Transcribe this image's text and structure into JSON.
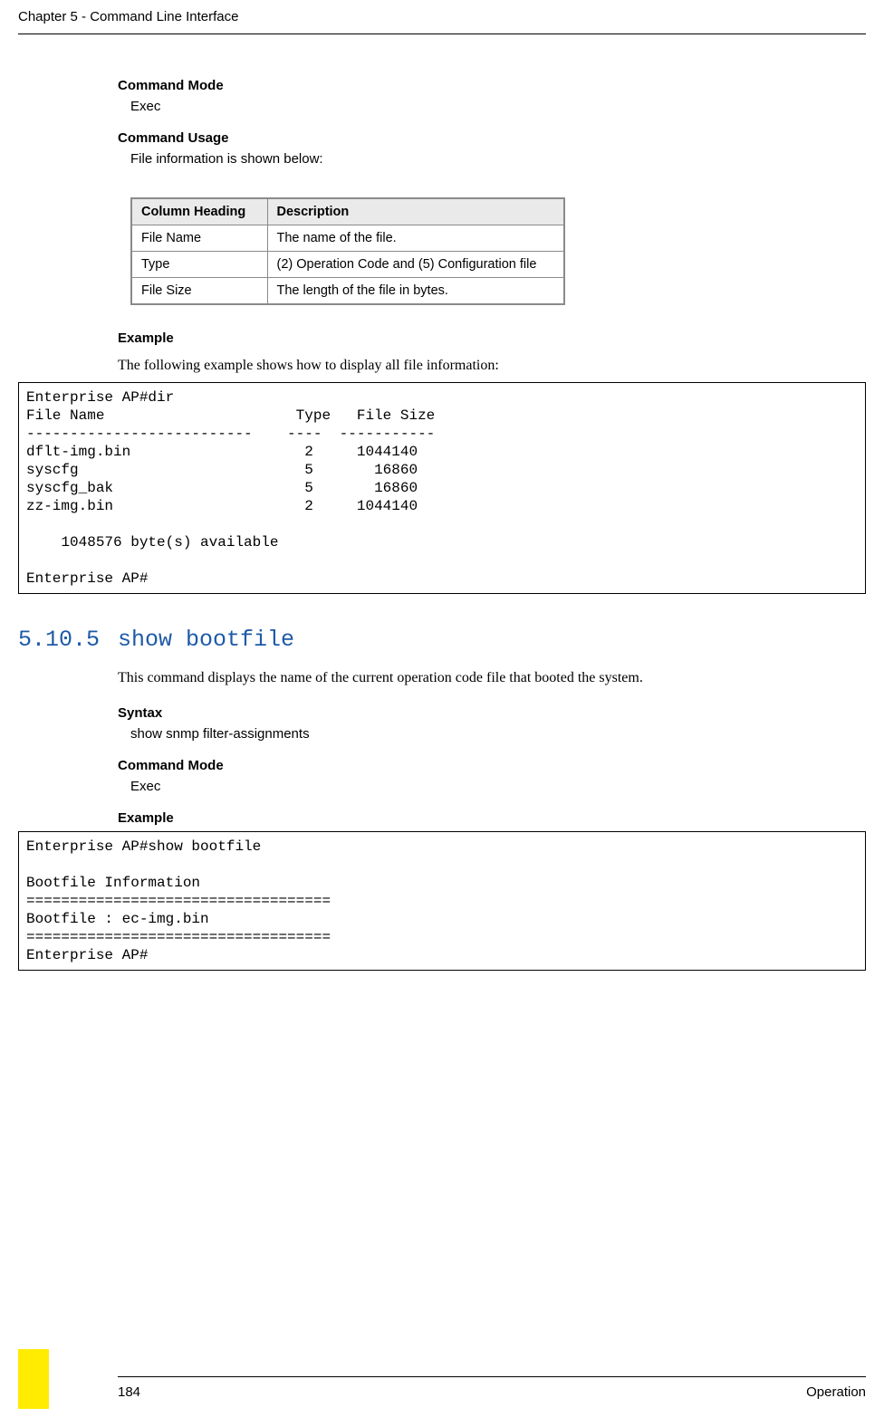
{
  "header": {
    "chapter": "Chapter 5 - Command Line Interface"
  },
  "s1": {
    "mode_label": "Command Mode",
    "mode_value": "Exec",
    "usage_label": "Command Usage",
    "usage_value": "File information is shown below:"
  },
  "table": {
    "col1": "Column Heading",
    "col2": "Description",
    "rows": [
      {
        "h": "File Name",
        "d": "The name of the file."
      },
      {
        "h": "Type",
        "d": "(2) Operation Code and (5) Configuration file"
      },
      {
        "h": "File Size",
        "d": "The length of the file in bytes."
      }
    ]
  },
  "example1": {
    "label": "Example",
    "intro": "The following example shows how to display all file information:",
    "code": "Enterprise AP#dir\nFile Name                      Type   File Size\n--------------------------    ----  -----------\ndflt-img.bin                    2     1044140\nsyscfg                          5       16860\nsyscfg_bak                      5       16860\nzz-img.bin                      2     1044140\n\n    1048576 byte(s) available\n\nEnterprise AP#"
  },
  "section": {
    "num": "5.10.5",
    "name": "show bootfile",
    "desc": "This command displays the name of the current operation code file that booted the system."
  },
  "s2": {
    "syntax_label": "Syntax",
    "syntax_value": "show snmp filter-assignments",
    "mode_label": "Command Mode",
    "mode_value": "Exec",
    "example_label": "Example",
    "code": "Enterprise AP#show bootfile\n\nBootfile Information\n===================================\nBootfile : ec-img.bin\n===================================\nEnterprise AP#"
  },
  "footer": {
    "page": "184",
    "label": "Operation"
  }
}
